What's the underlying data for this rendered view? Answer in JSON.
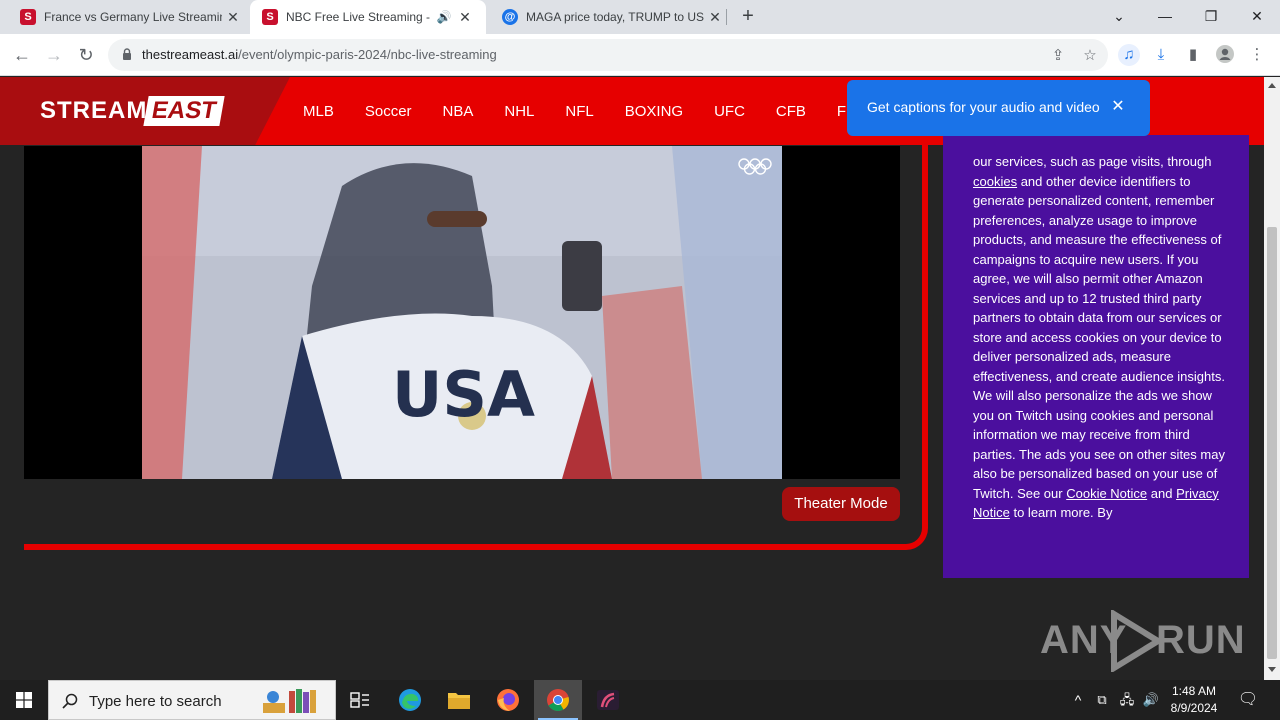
{
  "browser": {
    "tabs": [
      {
        "title": "France vs Germany Live Streamin",
        "favicon": "S",
        "favicon_color": "#c8102e",
        "active": false
      },
      {
        "title": "NBC Free Live Streaming - S",
        "favicon": "S",
        "favicon_color": "#c8102e",
        "active": true,
        "audio": true
      },
      {
        "title": "MAGA price today, TRUMP to US",
        "favicon": "@",
        "favicon_color": "#1a73e8",
        "active": false
      }
    ],
    "url_host": "thestreameast.ai",
    "url_path": "/event/olympic-paris-2024/nbc-live-streaming"
  },
  "site": {
    "logo_left": "STREAM",
    "logo_right": "EAST",
    "nav": [
      "MLB",
      "Soccer",
      "NBA",
      "NHL",
      "NFL",
      "BOXING",
      "UFC",
      "CFB",
      "F"
    ],
    "video_text": "USA",
    "theater_button": "Theater Mode",
    "consent_text": [
      "our services, such as page visits, through ",
      "cookies",
      " and other device identifiers to generate personalized content, remember preferences, analyze usage to improve products, and measure the effectiveness of campaigns to acquire new users. If you agree, we will also permit other Amazon services and up to 12 trusted third party partners to obtain data from our services or store and access cookies on your device to deliver personalized ads, measure effectiveness, and create audience insights. We will also personalize the ads we show you on Twitch using cookies and personal information we may receive from third parties. The ads you see on other sites may also be personalized based on your use of Twitch. See our ",
      "Cookie Notice",
      " and ",
      "Privacy Notice",
      " to learn more. By"
    ],
    "watermark_left": "ANY",
    "watermark_right": "RUN"
  },
  "caption_popup": {
    "message": "Get captions for your audio and video"
  },
  "taskbar": {
    "search_placeholder": "Type here to search",
    "time": "1:48 AM",
    "date": "8/9/2024"
  },
  "colors": {
    "site_red": "#e60000",
    "logo_dark_red": "#a90d10",
    "consent_purple": "#4b0f9e",
    "chrome_blue": "#1a73e8"
  }
}
